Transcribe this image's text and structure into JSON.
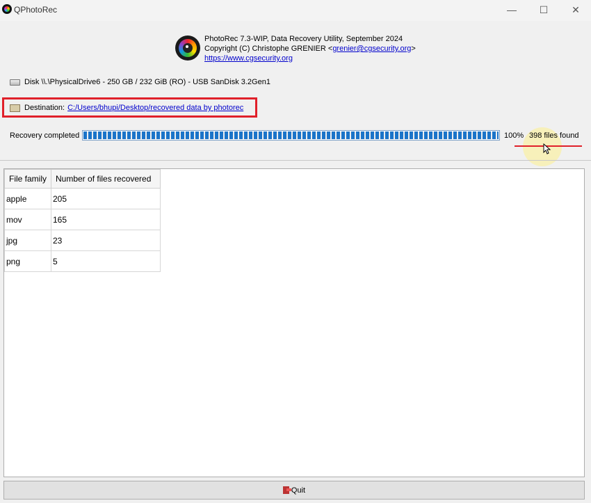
{
  "window": {
    "title": "QPhotoRec",
    "minimize": "—",
    "maximize": "☐",
    "close": "✕"
  },
  "header": {
    "line1": "PhotoRec 7.3-WIP, Data Recovery Utility, September 2024",
    "line2_prefix": "Copyright (C) Christophe GRENIER <",
    "email": "grenier@cgsecurity.org",
    "line2_suffix": ">",
    "website": "https://www.cgsecurity.org"
  },
  "disk": {
    "icon": "disk-icon",
    "label": "Disk \\\\.\\PhysicalDrive6 - 250 GB / 232 GiB (RO) -  USB  SanDisk 3.2Gen1"
  },
  "destination": {
    "icon": "folder-icon",
    "label": "Destination:",
    "path": "C:/Users/bhupi/Desktop/recovered data by photorec"
  },
  "progress": {
    "label": "Recovery completed",
    "value": 1.0,
    "percent_text": "100%",
    "files_found": "398 files found"
  },
  "table": {
    "columns": [
      "File family",
      "Number of files recovered"
    ],
    "rows": [
      [
        "apple",
        "205"
      ],
      [
        "mov",
        "165"
      ],
      [
        "jpg",
        "23"
      ],
      [
        "png",
        "5"
      ]
    ]
  },
  "footer": {
    "quit_label": "Quit",
    "quit_icon": "exit-icon"
  },
  "colors": {
    "highlight": "#e0202a",
    "progress_fill": "#1b74c9",
    "link": "#0000cc"
  }
}
